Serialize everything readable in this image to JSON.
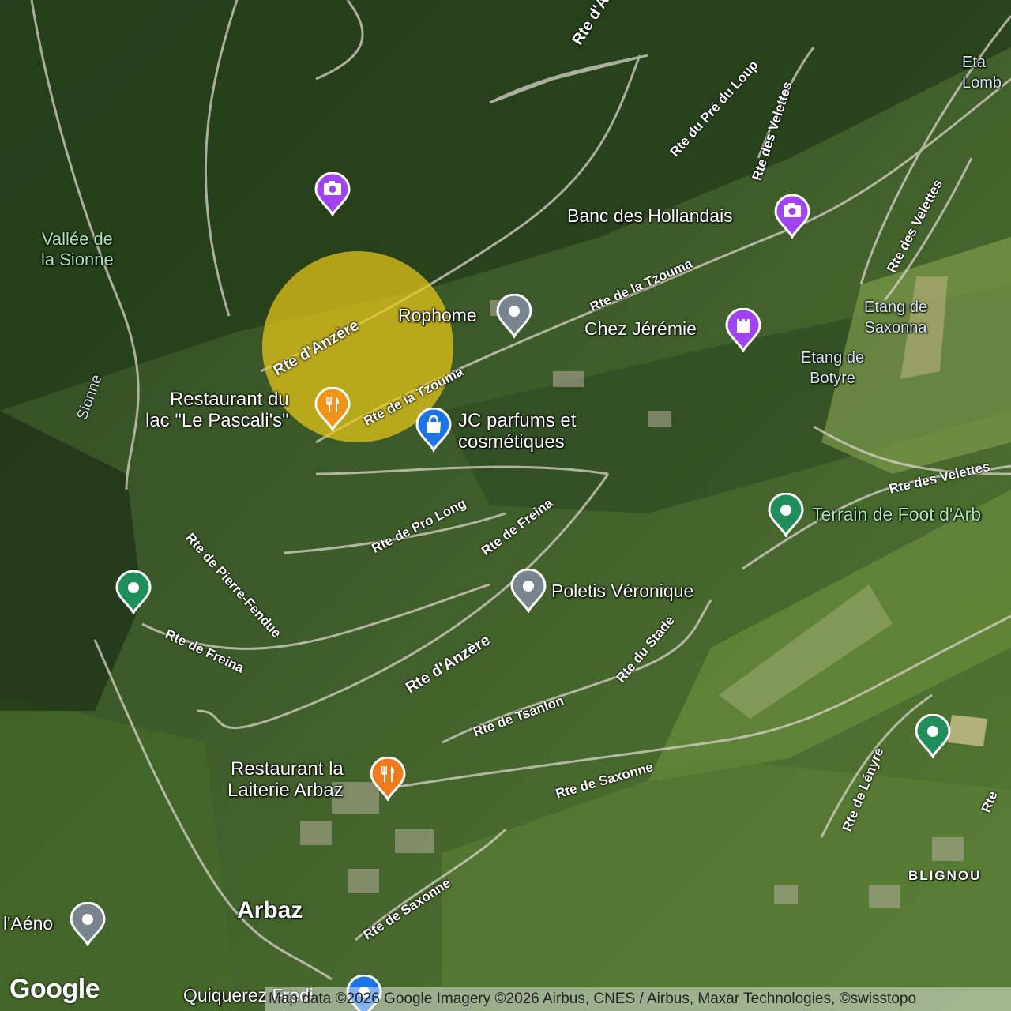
{
  "map": {
    "type": "satellite",
    "highlight_color": "#e8c818",
    "colors": {
      "photo": "#a142f4",
      "shop": "#1a73e8",
      "food": "#f27a1a",
      "generic": "#78858f",
      "park": "#1e8e5a",
      "landmark": "#a142f4"
    }
  },
  "places": {
    "banc_des_hollandais": "Banc des Hollandais",
    "rophome": "Rophome",
    "chez_jeremie": "Chez Jérémie",
    "restaurant_pascalis": "Restaurant du\nlac \"Le Pascali's\"",
    "jc_parfums": "JC parfums et\ncosmétiques",
    "poletis": "Poletis Véronique",
    "terrain_foot": "Terrain de Foot d'Arb",
    "restaurant_laiterie": "Restaurant la\nLaiterie Arbaz",
    "aeno": "l'Aéno",
    "quiquerez": "Quiquerez Fredi"
  },
  "natural": {
    "vallee": "Vallée de\nla Sionne",
    "etang_saxonna": "Etang de\nSaxonna",
    "etang_botyre": "Etang de\nBotyre",
    "etang_lombard": "Eta\nLomb",
    "sionne": "Sionne"
  },
  "towns": {
    "arbaz": "Arbaz",
    "blignou": "BLIGNOU"
  },
  "roads": {
    "anzere_top": "Rte d'An",
    "pre_du_loup": "Rte du Pré du Loup",
    "velettes_1": "Rte des Velettes",
    "velettes_2": "Rte des Velettes",
    "velettes_3": "Rte des Velettes",
    "tzouma_1": "Rte de la Tzouma",
    "anzere_1": "Rte d'Anzère",
    "tzouma_2": "Rte de la Tzouma",
    "pro_long": "Rte de Pro Long",
    "freina_1": "Rte de Freina",
    "pierre_fendue": "Rte de Pierre-Fendue",
    "freina_2": "Rte de Freina",
    "anzere_2": "Rte d'Anzère",
    "stade": "Rte du Stade",
    "tsanlon": "Rte de Tsanlon",
    "saxonne_1": "Rte de Saxonne",
    "lenyre": "Rte de Lényre",
    "saxonne_2": "Rte de Saxonne",
    "rte_edge": "Rte"
  },
  "footer": {
    "logo": "Google",
    "attribution": "Map data ©2026 Google Imagery ©2026 Airbus, CNES / Airbus, Maxar Technologies, ©swisstopo"
  }
}
